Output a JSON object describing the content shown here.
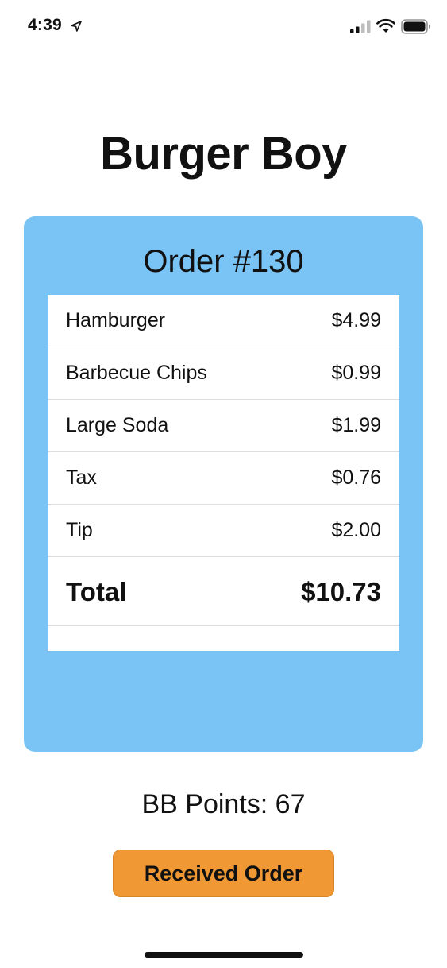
{
  "status_bar": {
    "time": "4:39",
    "icons": [
      "location-arrow-icon",
      "cellular-signal-icon",
      "wifi-icon",
      "battery-icon"
    ]
  },
  "title": "Burger Boy",
  "order": {
    "number_label": "Order #130",
    "items": [
      {
        "label": "Hamburger",
        "price": "$4.99"
      },
      {
        "label": "Barbecue Chips",
        "price": "$0.99"
      },
      {
        "label": "Large Soda",
        "price": "$1.99"
      },
      {
        "label": "Tax",
        "price": "$0.76"
      },
      {
        "label": "Tip",
        "price": "$2.00"
      }
    ],
    "total": {
      "label": "Total",
      "price": "$10.73"
    }
  },
  "points_label": "BB Points: 67",
  "received_button_label": "Received Order",
  "colors": {
    "card_background": "#79c3f5",
    "button_background": "#f09934",
    "text": "#111111",
    "page_background": "#ffffff"
  }
}
